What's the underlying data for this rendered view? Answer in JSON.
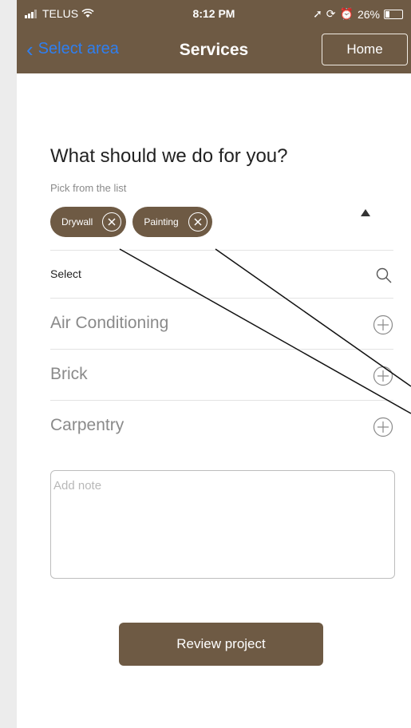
{
  "status_bar": {
    "carrier": "TELUS",
    "time": "8:12 PM",
    "battery": "26%"
  },
  "nav": {
    "back_label": "Select area",
    "title": "Services",
    "home_label": "Home"
  },
  "form": {
    "heading": "What should we do for you?",
    "subheading": "Pick from the list",
    "chips": [
      {
        "label": "Drywall"
      },
      {
        "label": "Painting"
      }
    ],
    "select_label": "Select",
    "items": [
      {
        "label": "Air Conditioning"
      },
      {
        "label": "Brick"
      },
      {
        "label": "Carpentry"
      }
    ],
    "note_placeholder": "Add note",
    "review_label": "Review project"
  },
  "colors": {
    "brand_brown": "#6e5a44",
    "link_blue": "#2f7ff0",
    "muted_text": "#8a8a8a"
  }
}
